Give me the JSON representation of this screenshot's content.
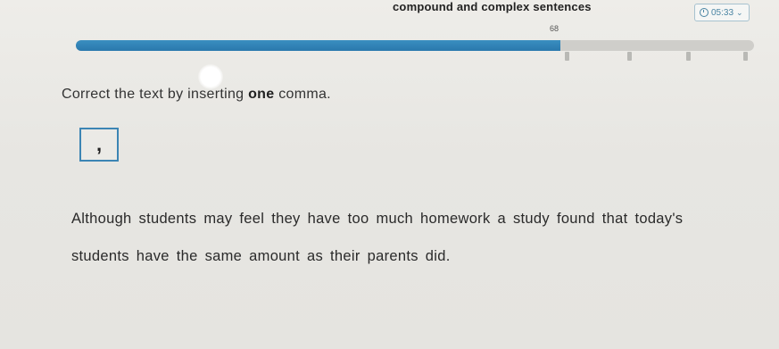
{
  "header": {
    "title": "compound and complex sentences",
    "timer": "05:33",
    "timer_icon": "clock-icon",
    "chevron_icon": "chevron-down-icon"
  },
  "progress": {
    "value": 68,
    "label": "68",
    "fill_color": "#2f82b6"
  },
  "question": {
    "instruction_before": "Correct the text by inserting ",
    "instruction_bold": "one",
    "instruction_after": " comma.",
    "draggable_token": ","
  },
  "sentence": {
    "line1": [
      "Although",
      "students",
      "may",
      "feel",
      "they",
      "have",
      "too",
      "much",
      "homework",
      "a",
      "study",
      "found",
      "that",
      "today's"
    ],
    "line2": [
      "students",
      "have",
      "the",
      "same",
      "amount",
      "as",
      "their",
      "parents",
      "did",
      "."
    ]
  },
  "colors": {
    "accent": "#3c85b4",
    "background": "#e9e8e4",
    "text": "#2a2a2a"
  }
}
